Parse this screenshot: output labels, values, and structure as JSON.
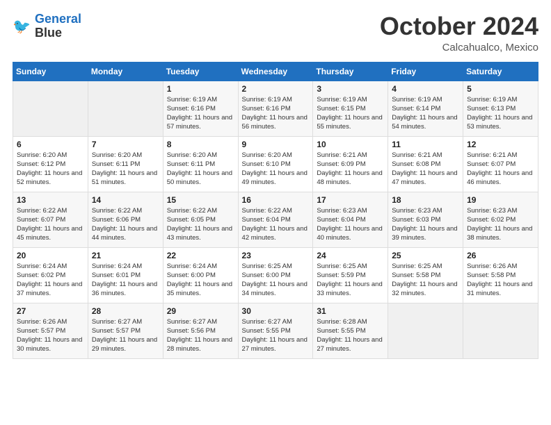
{
  "header": {
    "title": "October 2024",
    "location": "Calcahualco, Mexico"
  },
  "columns": [
    "Sunday",
    "Monday",
    "Tuesday",
    "Wednesday",
    "Thursday",
    "Friday",
    "Saturday"
  ],
  "weeks": [
    [
      {
        "day": "",
        "detail": ""
      },
      {
        "day": "",
        "detail": ""
      },
      {
        "day": "1",
        "detail": "Sunrise: 6:19 AM\nSunset: 6:16 PM\nDaylight: 11 hours and 57 minutes."
      },
      {
        "day": "2",
        "detail": "Sunrise: 6:19 AM\nSunset: 6:16 PM\nDaylight: 11 hours and 56 minutes."
      },
      {
        "day": "3",
        "detail": "Sunrise: 6:19 AM\nSunset: 6:15 PM\nDaylight: 11 hours and 55 minutes."
      },
      {
        "day": "4",
        "detail": "Sunrise: 6:19 AM\nSunset: 6:14 PM\nDaylight: 11 hours and 54 minutes."
      },
      {
        "day": "5",
        "detail": "Sunrise: 6:19 AM\nSunset: 6:13 PM\nDaylight: 11 hours and 53 minutes."
      }
    ],
    [
      {
        "day": "6",
        "detail": "Sunrise: 6:20 AM\nSunset: 6:12 PM\nDaylight: 11 hours and 52 minutes."
      },
      {
        "day": "7",
        "detail": "Sunrise: 6:20 AM\nSunset: 6:11 PM\nDaylight: 11 hours and 51 minutes."
      },
      {
        "day": "8",
        "detail": "Sunrise: 6:20 AM\nSunset: 6:11 PM\nDaylight: 11 hours and 50 minutes."
      },
      {
        "day": "9",
        "detail": "Sunrise: 6:20 AM\nSunset: 6:10 PM\nDaylight: 11 hours and 49 minutes."
      },
      {
        "day": "10",
        "detail": "Sunrise: 6:21 AM\nSunset: 6:09 PM\nDaylight: 11 hours and 48 minutes."
      },
      {
        "day": "11",
        "detail": "Sunrise: 6:21 AM\nSunset: 6:08 PM\nDaylight: 11 hours and 47 minutes."
      },
      {
        "day": "12",
        "detail": "Sunrise: 6:21 AM\nSunset: 6:07 PM\nDaylight: 11 hours and 46 minutes."
      }
    ],
    [
      {
        "day": "13",
        "detail": "Sunrise: 6:22 AM\nSunset: 6:07 PM\nDaylight: 11 hours and 45 minutes."
      },
      {
        "day": "14",
        "detail": "Sunrise: 6:22 AM\nSunset: 6:06 PM\nDaylight: 11 hours and 44 minutes."
      },
      {
        "day": "15",
        "detail": "Sunrise: 6:22 AM\nSunset: 6:05 PM\nDaylight: 11 hours and 43 minutes."
      },
      {
        "day": "16",
        "detail": "Sunrise: 6:22 AM\nSunset: 6:04 PM\nDaylight: 11 hours and 42 minutes."
      },
      {
        "day": "17",
        "detail": "Sunrise: 6:23 AM\nSunset: 6:04 PM\nDaylight: 11 hours and 40 minutes."
      },
      {
        "day": "18",
        "detail": "Sunrise: 6:23 AM\nSunset: 6:03 PM\nDaylight: 11 hours and 39 minutes."
      },
      {
        "day": "19",
        "detail": "Sunrise: 6:23 AM\nSunset: 6:02 PM\nDaylight: 11 hours and 38 minutes."
      }
    ],
    [
      {
        "day": "20",
        "detail": "Sunrise: 6:24 AM\nSunset: 6:02 PM\nDaylight: 11 hours and 37 minutes."
      },
      {
        "day": "21",
        "detail": "Sunrise: 6:24 AM\nSunset: 6:01 PM\nDaylight: 11 hours and 36 minutes."
      },
      {
        "day": "22",
        "detail": "Sunrise: 6:24 AM\nSunset: 6:00 PM\nDaylight: 11 hours and 35 minutes."
      },
      {
        "day": "23",
        "detail": "Sunrise: 6:25 AM\nSunset: 6:00 PM\nDaylight: 11 hours and 34 minutes."
      },
      {
        "day": "24",
        "detail": "Sunrise: 6:25 AM\nSunset: 5:59 PM\nDaylight: 11 hours and 33 minutes."
      },
      {
        "day": "25",
        "detail": "Sunrise: 6:25 AM\nSunset: 5:58 PM\nDaylight: 11 hours and 32 minutes."
      },
      {
        "day": "26",
        "detail": "Sunrise: 6:26 AM\nSunset: 5:58 PM\nDaylight: 11 hours and 31 minutes."
      }
    ],
    [
      {
        "day": "27",
        "detail": "Sunrise: 6:26 AM\nSunset: 5:57 PM\nDaylight: 11 hours and 30 minutes."
      },
      {
        "day": "28",
        "detail": "Sunrise: 6:27 AM\nSunset: 5:57 PM\nDaylight: 11 hours and 29 minutes."
      },
      {
        "day": "29",
        "detail": "Sunrise: 6:27 AM\nSunset: 5:56 PM\nDaylight: 11 hours and 28 minutes."
      },
      {
        "day": "30",
        "detail": "Sunrise: 6:27 AM\nSunset: 5:55 PM\nDaylight: 11 hours and 27 minutes."
      },
      {
        "day": "31",
        "detail": "Sunrise: 6:28 AM\nSunset: 5:55 PM\nDaylight: 11 hours and 27 minutes."
      },
      {
        "day": "",
        "detail": ""
      },
      {
        "day": "",
        "detail": ""
      }
    ]
  ]
}
